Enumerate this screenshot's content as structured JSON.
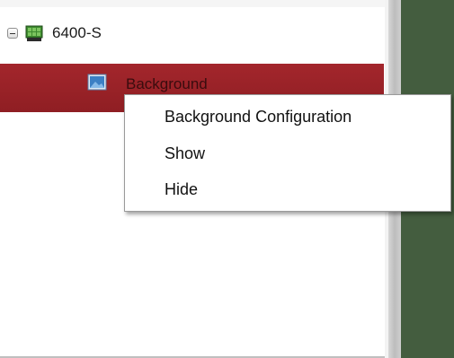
{
  "tree": {
    "root": {
      "label": "6400-S",
      "expanded": true,
      "expander_icon": "minus-expander-icon",
      "device_icon": "video-wall-device-icon",
      "device_icon_color": "#3d8a2e"
    },
    "selected": {
      "label": "Background",
      "icon": "background-image-icon",
      "highlight_color": "#a3262c"
    }
  },
  "context_menu": {
    "items": [
      {
        "label": "Background Configuration"
      },
      {
        "label": "Show"
      },
      {
        "label": "Hide"
      }
    ]
  },
  "colors": {
    "right_pane": "#445d3f"
  }
}
